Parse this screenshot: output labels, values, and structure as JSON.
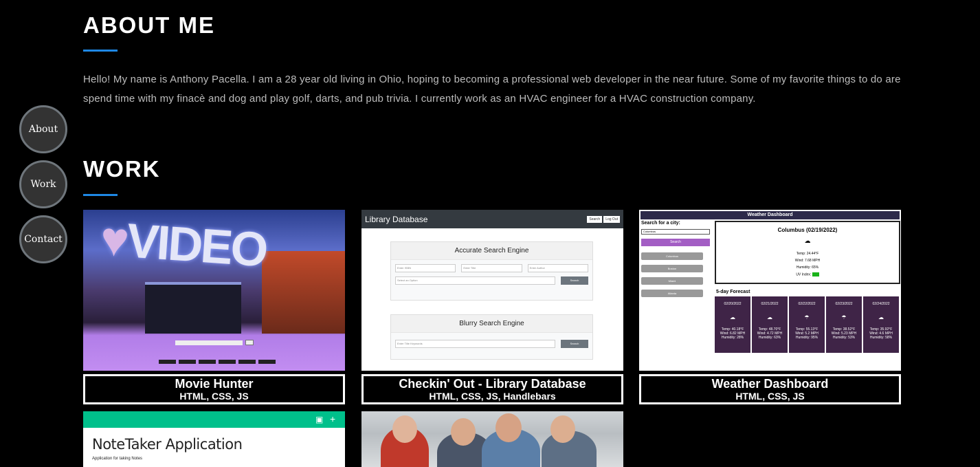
{
  "nav": {
    "about": "About",
    "work": "Work",
    "contact": "Contact"
  },
  "about": {
    "title": "ABOUT ME",
    "text": "Hello! My name is Anthony Pacella. I am a 28 year old living in Ohio, hoping to becoming a professional web developer in the near future. Some of my favorite things to do are spend time with my finacè and dog and play golf, darts, and pub trivia. I currently work as an HVAC engineer for a HVAC construction company."
  },
  "work": {
    "title": "WORK",
    "projects": [
      {
        "name": "Movie Hunter",
        "tech": "HTML, CSS, JS"
      },
      {
        "name": "Checkin' Out - Library Database",
        "tech": "HTML, CSS, JS, Handlebars"
      },
      {
        "name": "Weather Dashboard",
        "tech": "HTML, CSS, JS"
      }
    ]
  },
  "thumbs": {
    "movie": {
      "sign": "VIDEO",
      "heart": "♥"
    },
    "library": {
      "app_title": "Library Database",
      "search_btn": "Search",
      "logout_btn": "Log Out",
      "panel1_title": "Accurate Search Engine",
      "isbn_ph": "Enter ISBN",
      "title_ph": "Enter Title",
      "author_ph": "Enter Author",
      "select_ph": "Select an Option",
      "search": "Search",
      "panel2_title": "Blurry Search Engine",
      "keywords_ph": "Enter Title Keywords"
    },
    "weather": {
      "header": "Weather Dashboard",
      "search_label": "Search for a city:",
      "city_value": "Columbus",
      "search_btn": "Search",
      "cities": [
        "Columbus",
        "Boston",
        "Miami",
        "Atlanta"
      ],
      "current_title": "Columbus (02/19/2022)",
      "current_temp": "Temp: 24.44°F",
      "current_wind": "Wind: 7.68 MPH",
      "current_humidity": "Humidity: 65%",
      "current_uv": "UV Index:",
      "forecast_label": "5-day Forecast",
      "days": [
        {
          "date": "02/20/2022",
          "temp": "Temp: 40.18°F",
          "wind": "Wind: 6.82 MPH",
          "hum": "Humidity: 28%"
        },
        {
          "date": "02/21/2022",
          "temp": "Temp: 48.70°F",
          "wind": "Wind: 4.72 MPH",
          "hum": "Humidity: 63%"
        },
        {
          "date": "02/22/2022",
          "temp": "Temp: 55.13°F",
          "wind": "Wind: 5.2 MPH",
          "hum": "Humidity: 95%"
        },
        {
          "date": "02/23/2022",
          "temp": "Temp: 38.52°F",
          "wind": "Wind: 5.23 MPH",
          "hum": "Humidity: 53%"
        },
        {
          "date": "02/24/2022",
          "temp": "Temp: 35.92°F",
          "wind": "Wind: 4.6 MPH",
          "hum": "Humidity: 58%"
        }
      ]
    },
    "notetaker": {
      "title": "NoteTaker Application",
      "subtitle": "Application for taking Notes"
    }
  },
  "colors": {
    "accent": "#1e88e5",
    "nav_bg": "#333333",
    "nav_border": "#6f767c"
  }
}
